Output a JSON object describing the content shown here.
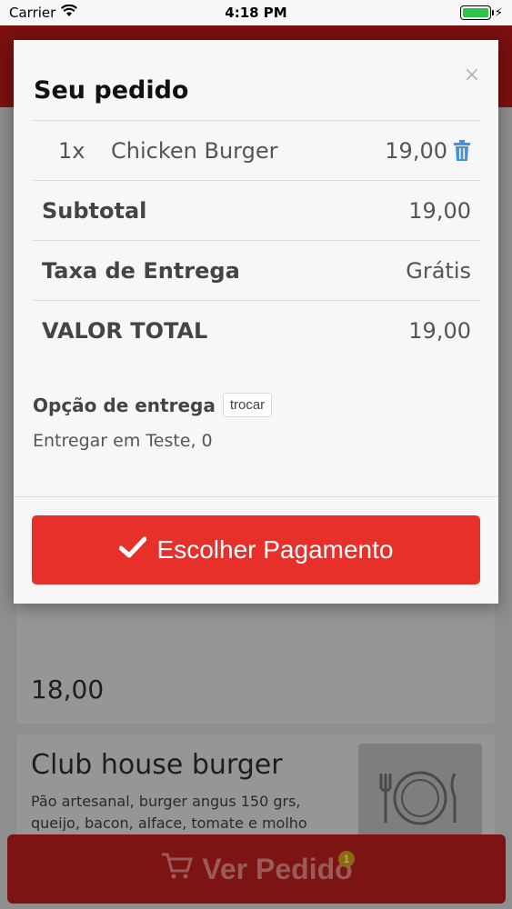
{
  "status_bar": {
    "carrier": "Carrier",
    "time": "4:18 PM"
  },
  "background": {
    "cards": [
      {
        "price": "18,00"
      },
      {
        "title": "Club house burger",
        "description": "Pão artesanal, burger angus 150 grs, queijo, bacon, alface, tomate e molho especial"
      }
    ],
    "bottom_button": {
      "label": "Ver Pedido",
      "badge": "1"
    }
  },
  "modal": {
    "title": "Seu pedido",
    "close_label": "×",
    "items": [
      {
        "qty": "1x",
        "name": "Chicken Burger",
        "price": "19,00"
      }
    ],
    "subtotal": {
      "label": "Subtotal",
      "value": "19,00"
    },
    "delivery_fee": {
      "label": "Taxa de Entrega",
      "value": "Grátis"
    },
    "total": {
      "label": "VALOR TOTAL",
      "value": "19,00"
    },
    "delivery_option": {
      "label": "Opção de entrega",
      "change_label": "trocar",
      "address": "Entregar em Teste, 0"
    },
    "pay_button": {
      "label": "Escolher Pagamento"
    }
  },
  "colors": {
    "accent_red": "#e8302b",
    "trash_blue": "#4a8fd9",
    "battery_green": "#2fc34a"
  }
}
